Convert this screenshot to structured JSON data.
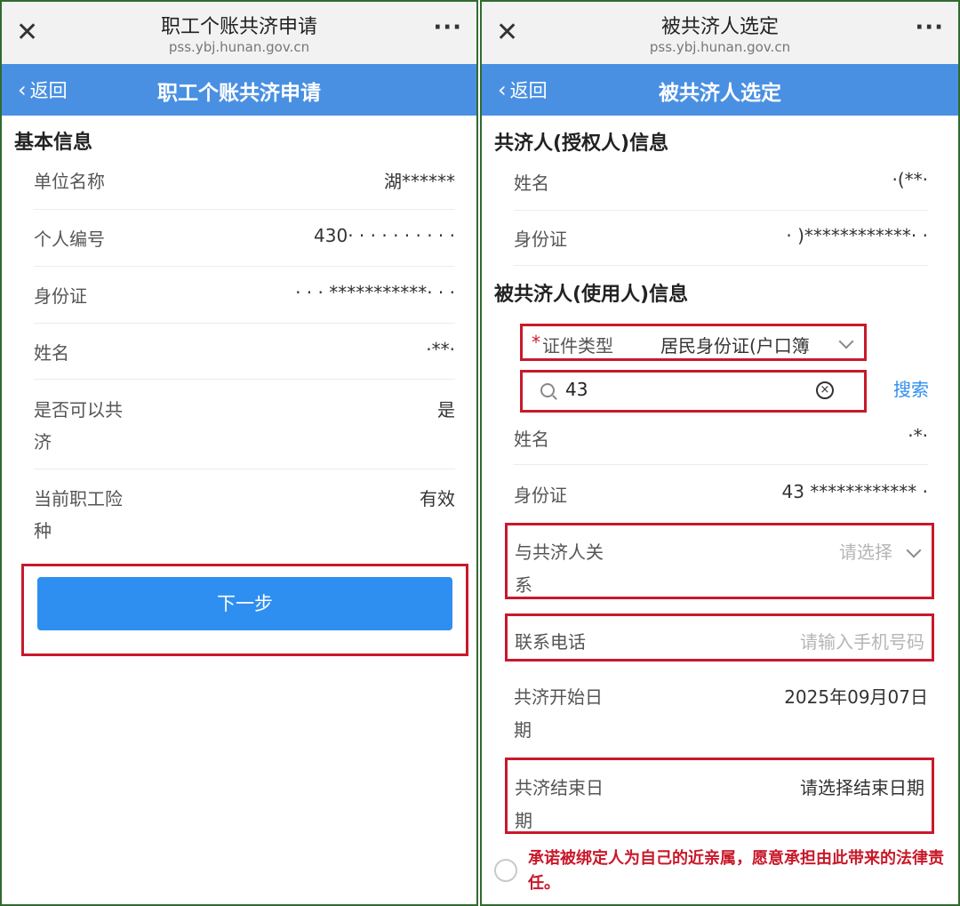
{
  "left": {
    "topbar": {
      "title": "职工个账共济申请",
      "url": "pss.ybj.hunan.gov.cn",
      "close": "✕",
      "more": "···"
    },
    "navbar": {
      "back": "返回",
      "title": "职工个账共济申请"
    },
    "section_title": "基本信息",
    "rows": [
      {
        "label": "单位名称",
        "value": "湖******"
      },
      {
        "label": "个人编号",
        "value": "430· · · · ·   · · · · ·"
      },
      {
        "label": "身份证",
        "value": "· · · ***********· · ·"
      },
      {
        "label": "姓名",
        "value": "·**·"
      },
      {
        "label": "是否可以共",
        "label2": "济",
        "value": "是"
      },
      {
        "label": "当前职工险",
        "label2": "种",
        "value": "有效"
      }
    ],
    "next_button": "下一步"
  },
  "right": {
    "topbar": {
      "title": "被共济人选定",
      "url": "pss.ybj.hunan.gov.cn",
      "close": "✕",
      "more": "···"
    },
    "navbar": {
      "back": "返回",
      "title": "被共济人选定"
    },
    "section1_title": "共济人(授权人)信息",
    "section1_rows": [
      {
        "label": "姓名",
        "value": "·(**·"
      },
      {
        "label": "身份证",
        "value": "· )************· ·"
      }
    ],
    "section2_title": "被共济人(使用人)信息",
    "id_type": {
      "required_mark": "*",
      "label": "证件类型",
      "value": "居民身份证(户口簿"
    },
    "search": {
      "value": "43",
      "clear": "×",
      "button": "搜索"
    },
    "section2_rows": [
      {
        "label": "姓名",
        "value": "·*·"
      },
      {
        "label": "身份证",
        "value": "43 ************  ·"
      }
    ],
    "relation": {
      "label": "与共济人关",
      "label2": "系",
      "placeholder": "请选择"
    },
    "phone": {
      "label": "联系电话",
      "placeholder": "请输入手机号码"
    },
    "start_date": {
      "label": "共济开始日",
      "label2": "期",
      "value": "2025年09月07日"
    },
    "end_date": {
      "label": "共济结束日",
      "label2": "期",
      "value": "请选择结束日期"
    },
    "agreement": "承诺被绑定人为自己的近亲属，愿意承担由此带来的法律责任。"
  },
  "colors": {
    "nav_blue": "#4a90e2",
    "button_blue": "#2f8ff0",
    "highlight_red": "#c8192a"
  }
}
